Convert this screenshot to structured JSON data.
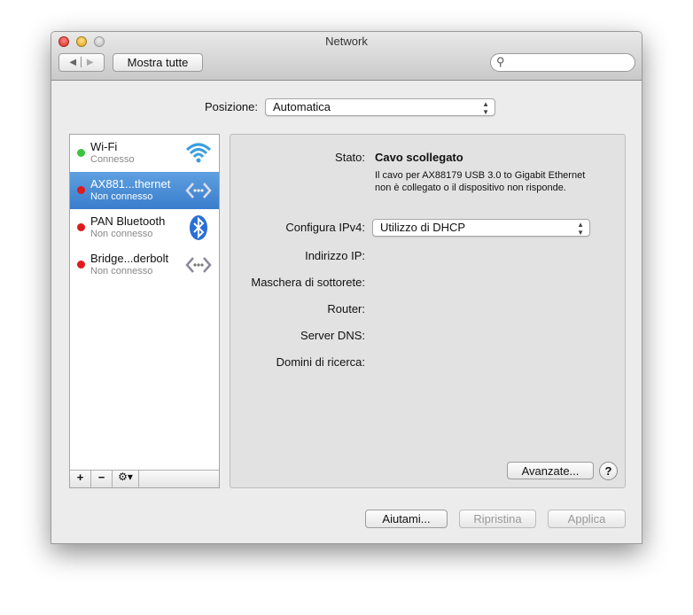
{
  "window": {
    "title": "Network"
  },
  "toolbar": {
    "back_icon": "chevron-left-icon",
    "forward_icon": "chevron-right-icon",
    "show_all_label": "Mostra tutte",
    "search_placeholder": ""
  },
  "location": {
    "label": "Posizione:",
    "value": "Automatica"
  },
  "services": [
    {
      "name": "Wi-Fi",
      "status": "Connesso",
      "status_color": "#3cc43c",
      "icon": "wifi-icon"
    },
    {
      "name": "AX881...thernet",
      "status": "Non connesso",
      "status_color": "#e0191c",
      "icon": "ethernet-icon",
      "selected": true
    },
    {
      "name": "PAN Bluetooth",
      "status": "Non connesso",
      "status_color": "#e0191c",
      "icon": "bluetooth-icon"
    },
    {
      "name": "Bridge...derbolt",
      "status": "Non connesso",
      "status_color": "#e0191c",
      "icon": "ethernet-icon"
    }
  ],
  "list_controls": {
    "add": "+",
    "remove": "−",
    "gear": "⚙▾"
  },
  "detail": {
    "status_label": "Stato:",
    "status_value": "Cavo scollegato",
    "status_desc": "Il cavo per AX88179 USB 3.0 to Gigabit Ethernet non è collegato o il dispositivo non risponde.",
    "ipv4_label": "Configura IPv4:",
    "ipv4_value": "Utilizzo di DHCP",
    "ip_label": "Indirizzo IP:",
    "mask_label": "Maschera di sottorete:",
    "router_label": "Router:",
    "dns_label": "Server DNS:",
    "domains_label": "Domini di ricerca:",
    "advanced_label": "Avanzate...",
    "help_label": "?"
  },
  "footer": {
    "help": "Aiutami...",
    "revert": "Ripristina",
    "apply": "Applica"
  }
}
